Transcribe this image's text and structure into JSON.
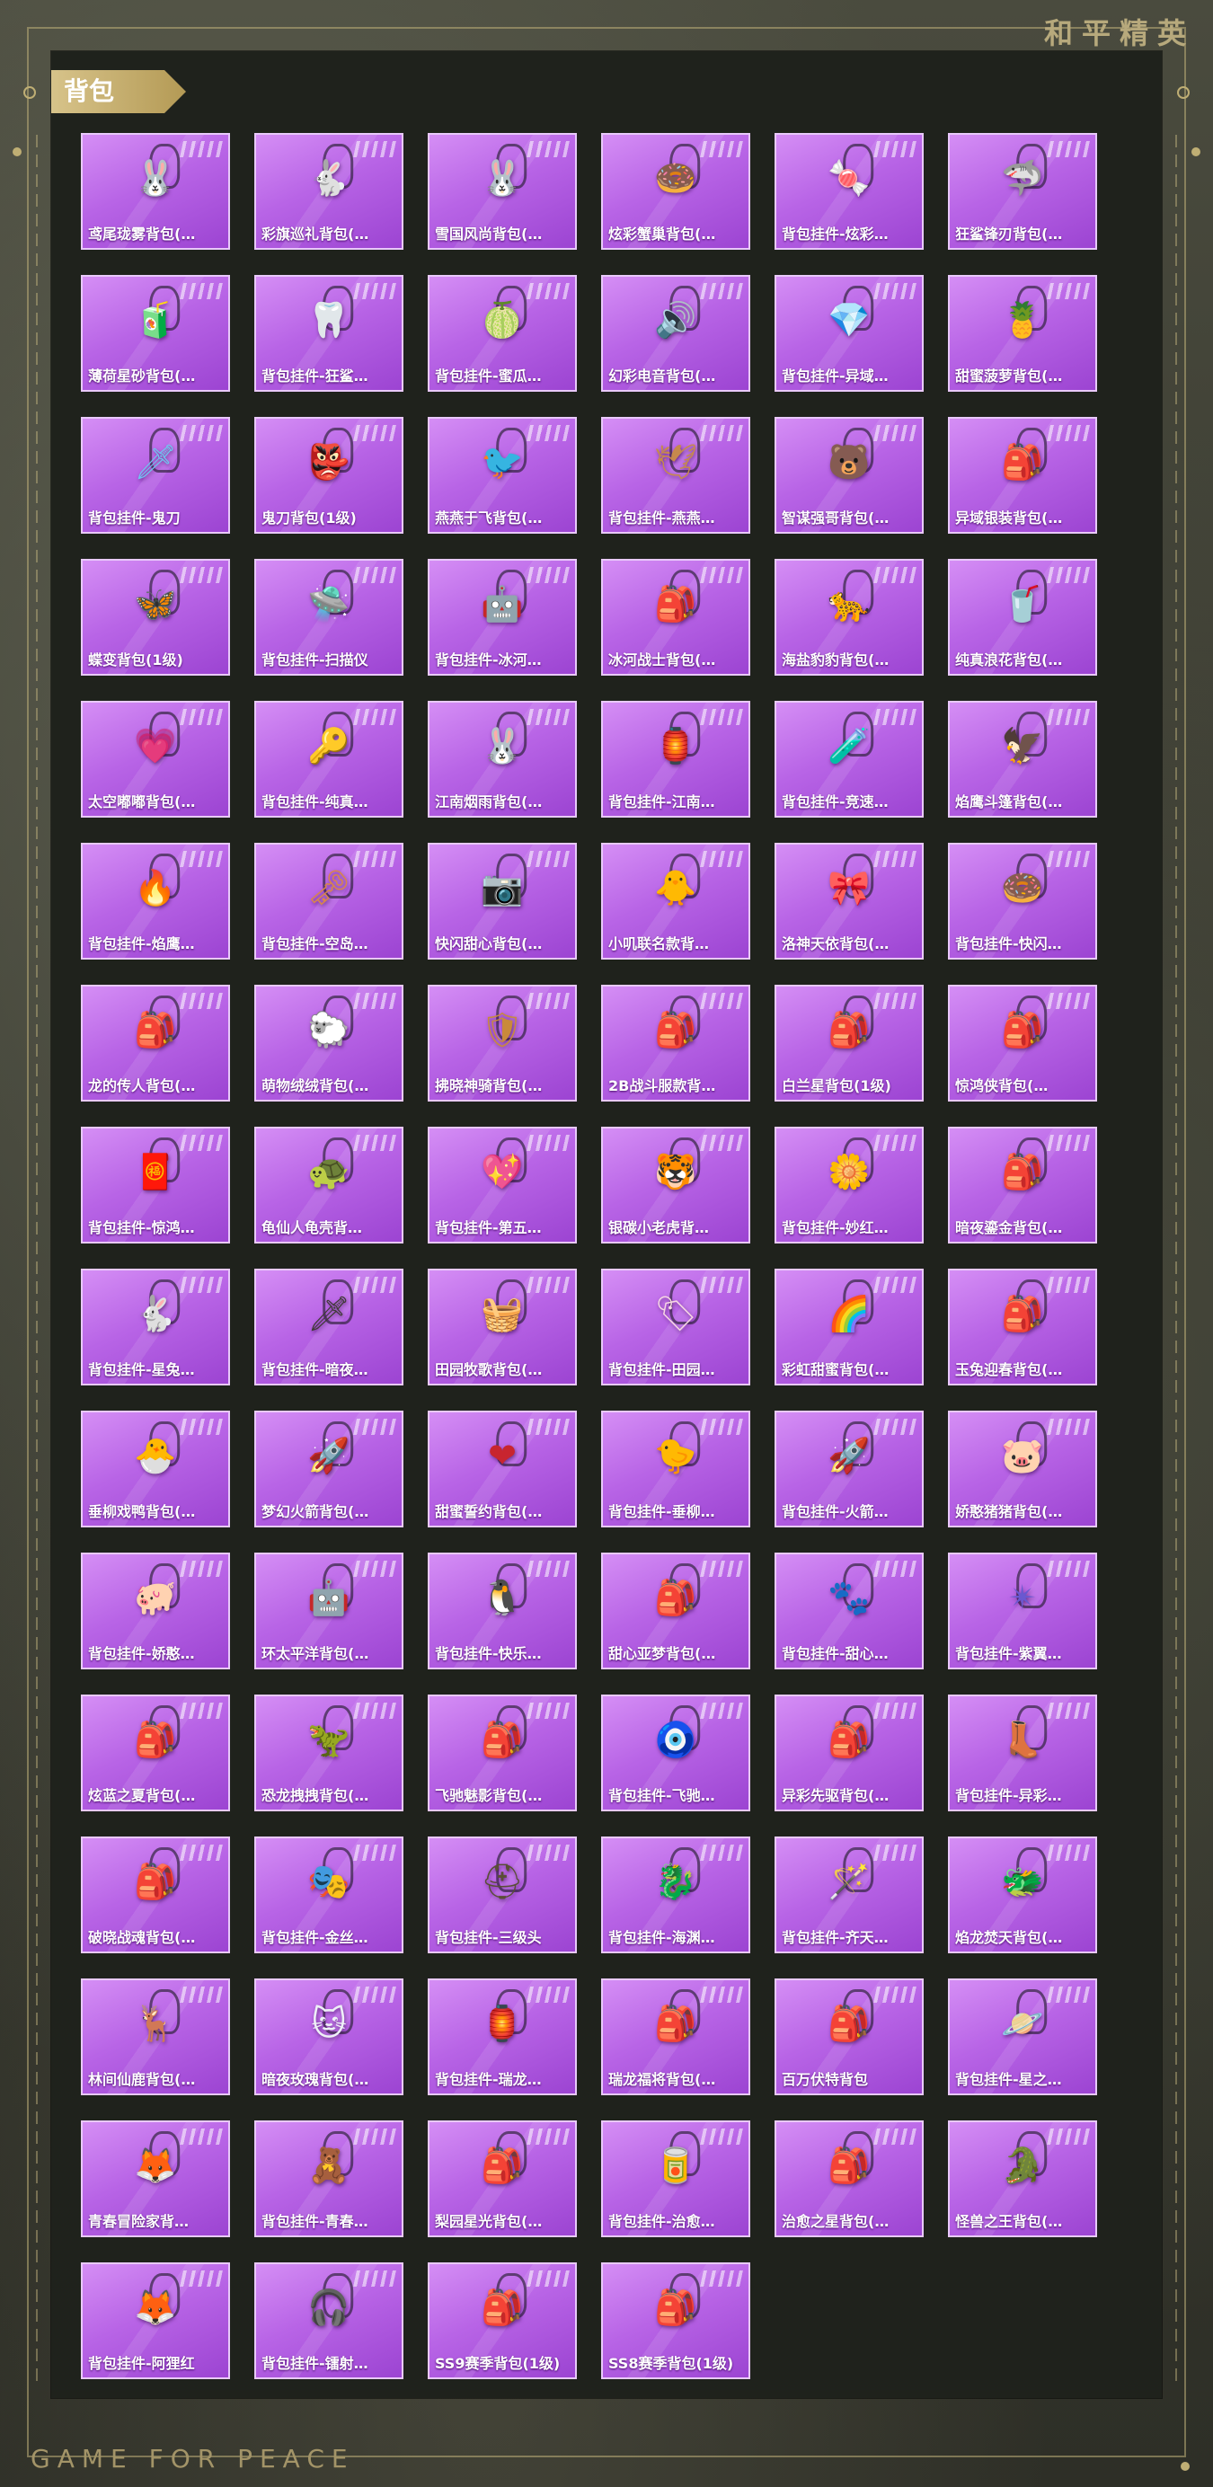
{
  "brand": "和平精英",
  "footer_brand": "GAME FOR PEACE",
  "section": {
    "title": "背包"
  },
  "items": [
    {
      "label": "鸢尾珑雾背包(…",
      "icon": "bunny-backpack-icon",
      "glyph": "🐰",
      "color": "#e6e6ea"
    },
    {
      "label": "彩旗巡礼背包(…",
      "icon": "bunny-backpack-icon",
      "glyph": "🐇",
      "color": "#f1e2dc"
    },
    {
      "label": "雪国风尚背包(…",
      "icon": "bunny-backpack-icon",
      "glyph": "🐰",
      "color": "#f7f7ff"
    },
    {
      "label": "炫彩蟹巢背包(…",
      "icon": "donut-backpack-icon",
      "glyph": "🍩",
      "color": "#f3a36b"
    },
    {
      "label": "背包挂件-炫彩…",
      "icon": "candy-charm-icon",
      "glyph": "🍬",
      "color": "#ff7fd0"
    },
    {
      "label": "狂鲨锋刃背包(…",
      "icon": "shark-backpack-icon",
      "glyph": "🦈",
      "color": "#3b3b46"
    },
    {
      "label": "薄荷星砂背包(…",
      "icon": "mint-backpack-icon",
      "glyph": "🧃",
      "color": "#aef3e0"
    },
    {
      "label": "背包挂件-狂鲨…",
      "icon": "fang-charm-icon",
      "glyph": "🦷",
      "color": "#d6c39a"
    },
    {
      "label": "背包挂件-蜜瓜…",
      "icon": "popsicle-charm-icon",
      "glyph": "🍈",
      "color": "#d9ef6a"
    },
    {
      "label": "幻彩电音背包(…",
      "icon": "speaker-backpack-icon",
      "glyph": "🔊",
      "color": "#4656b8"
    },
    {
      "label": "背包挂件-异域…",
      "icon": "gem-charm-icon",
      "glyph": "💎",
      "color": "#b8c1d4"
    },
    {
      "label": "甜蜜菠萝背包(…",
      "icon": "pineapple-backpack-icon",
      "glyph": "🍍",
      "color": "#f4c327"
    },
    {
      "label": "背包挂件-鬼刀",
      "icon": "blade-charm-icon",
      "glyph": "🗡",
      "color": "#6fc5f0"
    },
    {
      "label": "鬼刀背包(1级)",
      "icon": "mask-backpack-icon",
      "glyph": "👺",
      "color": "#ece4d7"
    },
    {
      "label": "燕燕于飞背包(…",
      "icon": "swallow-backpack-icon",
      "glyph": "🐦",
      "color": "#f7f7f7"
    },
    {
      "label": "背包挂件-燕燕…",
      "icon": "swallow-charm-icon",
      "glyph": "🕊",
      "color": "#c6894d"
    },
    {
      "label": "智谋强哥背包(…",
      "icon": "bear-backpack-icon",
      "glyph": "🐻",
      "color": "#d69b48"
    },
    {
      "label": "异域银装背包(…",
      "icon": "armor-backpack-icon",
      "glyph": "🎒",
      "color": "#2d3347"
    },
    {
      "label": "蝶变背包(1级)",
      "icon": "butterfly-backpack-icon",
      "glyph": "🦋",
      "color": "#3b3442"
    },
    {
      "label": "背包挂件-扫描仪",
      "icon": "drone-charm-icon",
      "glyph": "🛸",
      "color": "#ecf2f7"
    },
    {
      "label": "背包挂件-冰河…",
      "icon": "robot-charm-icon",
      "glyph": "🤖",
      "color": "#e4e9ef"
    },
    {
      "label": "冰河战士背包(…",
      "icon": "warrior-backpack-icon",
      "glyph": "🎒",
      "color": "#58b5e2"
    },
    {
      "label": "海盐豹豹背包(…",
      "icon": "leopard-backpack-icon",
      "glyph": "🐆",
      "color": "#9be4f2"
    },
    {
      "label": "纯真浪花背包(…",
      "icon": "drink-backpack-icon",
      "glyph": "🥤",
      "color": "#68c6e8"
    },
    {
      "label": "太空嘟嘟背包(…",
      "icon": "heart-backpack-icon",
      "glyph": "💗",
      "color": "#ff7fbf"
    },
    {
      "label": "背包挂件-纯真…",
      "icon": "key-charm-icon",
      "glyph": "🔑",
      "color": "#f5c742"
    },
    {
      "label": "江南烟雨背包(…",
      "icon": "rabbit-backpack-icon",
      "glyph": "🐰",
      "color": "#f7eef1"
    },
    {
      "label": "背包挂件-江南…",
      "icon": "lantern-charm-icon",
      "glyph": "🏮",
      "color": "#f7eaf4"
    },
    {
      "label": "背包挂件-竞速…",
      "icon": "bottle-charm-icon",
      "glyph": "🧪",
      "color": "#9de14a"
    },
    {
      "label": "焰鹰斗篷背包(…",
      "icon": "cloak-backpack-icon",
      "glyph": "🦅",
      "color": "#c0313d"
    },
    {
      "label": "背包挂件-焰鹰…",
      "icon": "flame-charm-icon",
      "glyph": "🔥",
      "color": "#d33b3b"
    },
    {
      "label": "背包挂件-空岛…",
      "icon": "key-charm-icon",
      "glyph": "🗝",
      "color": "#d9864a"
    },
    {
      "label": "快闪甜心背包(…",
      "icon": "camera-backpack-icon",
      "glyph": "📷",
      "color": "#e7838c"
    },
    {
      "label": "小叽联名款背…",
      "icon": "bird-backpack-icon",
      "glyph": "🐥",
      "color": "#f7d4e0"
    },
    {
      "label": "洛神天依背包(…",
      "icon": "bow-backpack-icon",
      "glyph": "🎀",
      "color": "#a8d8ef"
    },
    {
      "label": "背包挂件-快闪…",
      "icon": "donut-charm-icon",
      "glyph": "🍩",
      "color": "#f6a5c4"
    },
    {
      "label": "龙的传人背包(…",
      "icon": "dragon-backpack-icon",
      "glyph": "🎒",
      "color": "#d63b3b"
    },
    {
      "label": "萌物绒绒背包(…",
      "icon": "plush-backpack-icon",
      "glyph": "🐑",
      "color": "#f7f2f6"
    },
    {
      "label": "拂晓神骑背包(…",
      "icon": "knight-backpack-icon",
      "glyph": "🛡",
      "color": "#c98a3b"
    },
    {
      "label": "2B战斗服款背…",
      "icon": "combat-backpack-icon",
      "glyph": "🎒",
      "color": "#2a2a2e"
    },
    {
      "label": "白兰星背包(1级)",
      "icon": "star-backpack-icon",
      "glyph": "🎒",
      "color": "#f6c9d6"
    },
    {
      "label": "惊鸿侠背包(…",
      "icon": "hero-backpack-icon",
      "glyph": "🎒",
      "color": "#33363f"
    },
    {
      "label": "背包挂件-惊鸿…",
      "icon": "tassel-charm-icon",
      "glyph": "🧧",
      "color": "#c22b35"
    },
    {
      "label": "龟仙人龟壳背…",
      "icon": "shell-backpack-icon",
      "glyph": "🐢",
      "color": "#7a3bbf"
    },
    {
      "label": "背包挂件-第五…",
      "icon": "heart-charm-icon",
      "glyph": "💖",
      "color": "#f7b7d2"
    },
    {
      "label": "银碳小老虎背…",
      "icon": "tiger-backpack-icon",
      "glyph": "🐯",
      "color": "#3a3a3f"
    },
    {
      "label": "背包挂件-妙红…",
      "icon": "flower-charm-icon",
      "glyph": "🌼",
      "color": "#fff7f7"
    },
    {
      "label": "暗夜鎏金背包(…",
      "icon": "gold-backpack-icon",
      "glyph": "🎒",
      "color": "#2e2d28"
    },
    {
      "label": "背包挂件-星兔…",
      "icon": "rabbit-charm-icon",
      "glyph": "🐇",
      "color": "#e1e8f7"
    },
    {
      "label": "背包挂件-暗夜…",
      "icon": "sword-charm-icon",
      "glyph": "🗡",
      "color": "#3e3a34"
    },
    {
      "label": "田园牧歌背包(…",
      "icon": "basket-backpack-icon",
      "glyph": "🧺",
      "color": "#e2c78b"
    },
    {
      "label": "背包挂件-田园…",
      "icon": "tag-charm-icon",
      "glyph": "🏷",
      "color": "#f7d7e4"
    },
    {
      "label": "彩虹甜蜜背包(…",
      "icon": "rainbow-backpack-icon",
      "glyph": "🌈",
      "color": "#f7e3ef"
    },
    {
      "label": "玉兔迎春背包(…",
      "icon": "bunny-red-backpack-icon",
      "glyph": "🎒",
      "color": "#d62f3c"
    },
    {
      "label": "垂柳戏鸭背包(…",
      "icon": "duck-backpack-icon",
      "glyph": "🐣",
      "color": "#f7cf74"
    },
    {
      "label": "梦幻火箭背包(…",
      "icon": "rocket-backpack-icon",
      "glyph": "🚀",
      "color": "#3a3550"
    },
    {
      "label": "甜蜜誓约背包(…",
      "icon": "heart-red-backpack-icon",
      "glyph": "❤",
      "color": "#c8252f"
    },
    {
      "label": "背包挂件-垂柳…",
      "icon": "duck-charm-icon",
      "glyph": "🐤",
      "color": "#f7c24b"
    },
    {
      "label": "背包挂件-火箭…",
      "icon": "rocket-charm-icon",
      "glyph": "🚀",
      "color": "#e0357a"
    },
    {
      "label": "娇憨猪猪背包(…",
      "icon": "pig-backpack-icon",
      "glyph": "🐷",
      "color": "#f7c7cf"
    },
    {
      "label": "背包挂件-娇憨…",
      "icon": "pig-charm-icon",
      "glyph": "🐖",
      "color": "#f7cfe0"
    },
    {
      "label": "环太平洋背包(…",
      "icon": "mech-backpack-icon",
      "glyph": "🤖",
      "color": "#2d4a6e"
    },
    {
      "label": "背包挂件-快乐…",
      "icon": "bird-charm-icon",
      "glyph": "🐧",
      "color": "#2a2a2a"
    },
    {
      "label": "甜心亚梦背包(…",
      "icon": "dream-backpack-icon",
      "glyph": "🎒",
      "color": "#2c2628"
    },
    {
      "label": "背包挂件-甜心…",
      "icon": "paw-charm-icon",
      "glyph": "🐾",
      "color": "#f27d72"
    },
    {
      "label": "背包挂件-紫翼…",
      "icon": "wing-charm-icon",
      "glyph": "✴",
      "color": "#6a58d0"
    },
    {
      "label": "炫蓝之夏背包(…",
      "icon": "summer-backpack-icon",
      "glyph": "🎒",
      "color": "#27b0b5"
    },
    {
      "label": "恐龙拽拽背包(…",
      "icon": "dino-backpack-icon",
      "glyph": "🦖",
      "color": "#8fc63a"
    },
    {
      "label": "飞驰魅影背包(…",
      "icon": "racer-backpack-icon",
      "glyph": "🎒",
      "color": "#f2f2f2"
    },
    {
      "label": "背包挂件-飞驰…",
      "icon": "eye-charm-icon",
      "glyph": "🧿",
      "color": "#3b8cf0"
    },
    {
      "label": "异彩先驱背包(…",
      "icon": "pioneer-backpack-icon",
      "glyph": "🎒",
      "color": "#f7d7ec"
    },
    {
      "label": "背包挂件-异彩…",
      "icon": "boot-charm-icon",
      "glyph": "👢",
      "color": "#f07ccd"
    },
    {
      "label": "破晓战魂背包(…",
      "icon": "soul-backpack-icon",
      "glyph": "🎒",
      "color": "#5b2329"
    },
    {
      "label": "背包挂件-金丝…",
      "icon": "mask-charm-icon",
      "glyph": "🎭",
      "color": "#e8dcc8"
    },
    {
      "label": "背包挂件-三级头",
      "icon": "helmet-charm-icon",
      "glyph": "⛑",
      "color": "#5a4e36"
    },
    {
      "label": "背包挂件-海渊…",
      "icon": "seahorse-charm-icon",
      "glyph": "🐉",
      "color": "#5b82c9"
    },
    {
      "label": "背包挂件-齐天…",
      "icon": "staff-charm-icon",
      "glyph": "🪄",
      "color": "#c63b3b"
    },
    {
      "label": "焰龙焚天背包(…",
      "icon": "fire-dragon-backpack-icon",
      "glyph": "🐲",
      "color": "#2a2225"
    },
    {
      "label": "林间仙鹿背包(…",
      "icon": "deer-backpack-icon",
      "glyph": "🦌",
      "color": "#f7c9d6"
    },
    {
      "label": "暗夜玫瑰背包(…",
      "icon": "rose-backpack-icon",
      "glyph": "🐱",
      "color": "#eef0f7"
    },
    {
      "label": "背包挂件-瑞龙…",
      "icon": "ornament-charm-icon",
      "glyph": "🏮",
      "color": "#e45b3a"
    },
    {
      "label": "瑞龙福将背包(…",
      "icon": "general-backpack-icon",
      "glyph": "🎒",
      "color": "#b53a27"
    },
    {
      "label": "百万伏特背包",
      "icon": "volt-backpack-icon",
      "glyph": "🎒",
      "color": "#2c2c2e"
    },
    {
      "label": "背包挂件-星之…",
      "icon": "planet-charm-icon",
      "glyph": "🪐",
      "color": "#7d3bcf"
    },
    {
      "label": "青春冒险家背…",
      "icon": "adventure-backpack-icon",
      "glyph": "🦊",
      "color": "#ef5b3a"
    },
    {
      "label": "背包挂件-青春…",
      "icon": "bear-charm-icon",
      "glyph": "🧸",
      "color": "#f06a7a"
    },
    {
      "label": "梨园星光背包(…",
      "icon": "opera-backpack-icon",
      "glyph": "🎒",
      "color": "#c9302c"
    },
    {
      "label": "背包挂件-治愈…",
      "icon": "can-charm-icon",
      "glyph": "🥫",
      "color": "#7ad6b5"
    },
    {
      "label": "治愈之星背包(…",
      "icon": "healing-backpack-icon",
      "glyph": "🎒",
      "color": "#e7e0ea"
    },
    {
      "label": "怪兽之王背包(…",
      "icon": "monster-backpack-icon",
      "glyph": "🐊",
      "color": "#2a2d38"
    },
    {
      "label": "背包挂件-阿狸红",
      "icon": "fox-charm-icon",
      "glyph": "🦊",
      "color": "#e74a4a"
    },
    {
      "label": "背包挂件-镭射…",
      "icon": "headphone-charm-icon",
      "glyph": "🎧",
      "color": "#c9c9d3"
    },
    {
      "label": "SS9赛季背包(1级)",
      "icon": "season-backpack-icon",
      "glyph": "🎒",
      "color": "#9a6a3b"
    },
    {
      "label": "SS8赛季背包(1级)",
      "icon": "season-backpack-icon",
      "glyph": "🎒",
      "color": "#273a4e"
    }
  ]
}
